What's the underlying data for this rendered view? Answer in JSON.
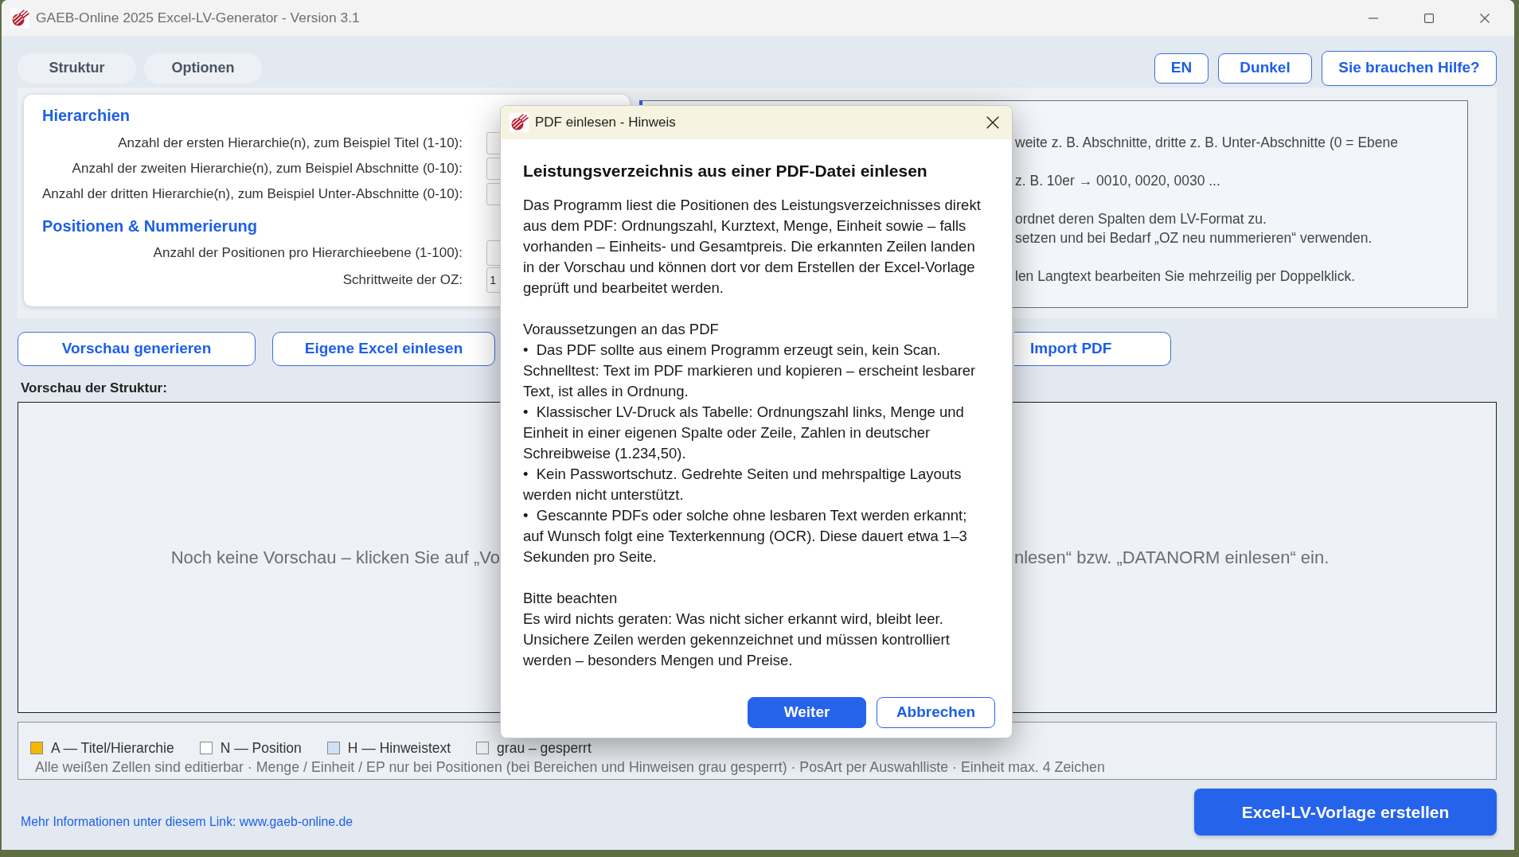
{
  "window": {
    "title": "GAEB-Online 2025 Excel-LV-Generator - Version 3.1"
  },
  "tabs": [
    {
      "label": "Struktur",
      "selected": false
    },
    {
      "label": "Optionen",
      "selected": false
    }
  ],
  "header_buttons": [
    {
      "label": "EN"
    },
    {
      "label": "Dunkel"
    },
    {
      "label": "Sie brauchen Hilfe?"
    }
  ],
  "settings_card": {
    "sections": [
      {
        "title": "Hierarchien",
        "fields": [
          {
            "label": "Anzahl der ersten Hierarchie(n), zum Beispiel Titel (1-10):"
          },
          {
            "label": "Anzahl der zweiten Hierarchie(n), zum Beispiel Abschnitte (0-10):"
          },
          {
            "label": "Anzahl der dritten Hierarchie(n), zum Beispiel Unter-Abschnitte (0-10):"
          }
        ]
      },
      {
        "title": "Positionen & Nummerierung",
        "fields": [
          {
            "label": "Anzahl der Positionen pro Hierarchieebene (1-100):"
          },
          {
            "label": "Schrittweite der OZ:",
            "value": "1"
          }
        ]
      }
    ]
  },
  "help_panel": {
    "paragraphs": [
      {
        "lines": [
          "weite z. B. Abschnitte, dritte z. B. Unter-Abschnitte (0 = Ebene"
        ]
      },
      {
        "lines": [
          "z. B. 10er → 0010, 0020, 0030 ..."
        ]
      },
      {
        "lines": [
          "ordnet deren Spalten dem LV-Format zu.",
          "setzen und bei Bedarf „OZ neu nummerieren“ verwenden."
        ]
      },
      {
        "lines": [
          "len Langtext bearbeiten Sie mehrzeilig per Doppelklick."
        ]
      }
    ]
  },
  "action_buttons": [
    {
      "label": "Vorschau generieren"
    },
    {
      "label": "Eigene Excel einlesen"
    },
    {
      "label": "Import PDF"
    }
  ],
  "preview": {
    "label": "Vorschau der Struktur:",
    "placeholder_parts": [
      "Noch keine Vorschau – klicken Sie auf „Vo",
      "nlesen“ bzw. „DATANORM einlesen“ ein."
    ]
  },
  "legend": {
    "items": [
      {
        "label": "A — Titel/Hierarchie",
        "color": "#f5b800"
      },
      {
        "label": "N — Position",
        "color": "#ffffff"
      },
      {
        "label": "H — Hinweistext",
        "color": "#cfe2f5"
      },
      {
        "label": "grau – gesperrt",
        "color": "#eeeeee"
      }
    ],
    "note": "Alle weißen Zellen sind editierbar · Menge / Einheit / EP nur bei Positionen (bei Bereichen und Hinweisen grau gesperrt) · PosArt per Auswahlliste · Einheit max. 4 Zeichen"
  },
  "footer": {
    "link": "Mehr Informationen unter diesem Link: www.gaeb-online.de",
    "create_button": "Excel-LV-Vorlage erstellen"
  },
  "dialog": {
    "title": "PDF einlesen - Hinweis",
    "heading": "Leistungsverzeichnis aus einer PDF-Datei einlesen",
    "intro": "Das Programm liest die Positionen des Leistungsverzeichnisses direkt aus dem PDF: Ordnungszahl, Kurztext, Menge, Einheit sowie – falls vorhanden – Einheits- und Gesamtpreis. Die erkannten Zeilen landen in der Vorschau und können dort vor dem Erstellen der Excel-Vorlage geprüft und bearbeitet werden.",
    "sections": [
      {
        "title": "Voraussetzungen an das PDF",
        "paragraphs": [
          "•  Das PDF sollte aus einem Programm erzeugt sein, kein Scan. Schnelltest: Text im PDF markieren und kopieren – erscheint lesbarer Text, ist alles in Ordnung.",
          "•  Klassischer LV-Druck als Tabelle: Ordnungszahl links, Menge und Einheit in einer eigenen Spalte oder Zeile, Zahlen in deutscher Schreibweise (1.234,50).",
          "•  Kein Passwortschutz. Gedrehte Seiten und mehrspaltige Layouts werden nicht unterstützt.",
          "•  Gescannte PDFs oder solche ohne lesbaren Text werden erkannt; auf Wunsch folgt eine Texterkennung (OCR). Diese dauert etwa 1–3 Sekunden pro Seite."
        ]
      },
      {
        "title": "Bitte beachten",
        "paragraphs": [
          "Es wird nichts geraten: Was nicht sicher erkannt wird, bleibt leer. Unsichere Zeilen werden gekennzeichnet und müssen kontrolliert werden – besonders Mengen und Preise."
        ]
      }
    ],
    "buttons": [
      {
        "label": "Weiter",
        "kind": "primary"
      },
      {
        "label": "Abbrechen",
        "kind": "secondary"
      }
    ]
  }
}
